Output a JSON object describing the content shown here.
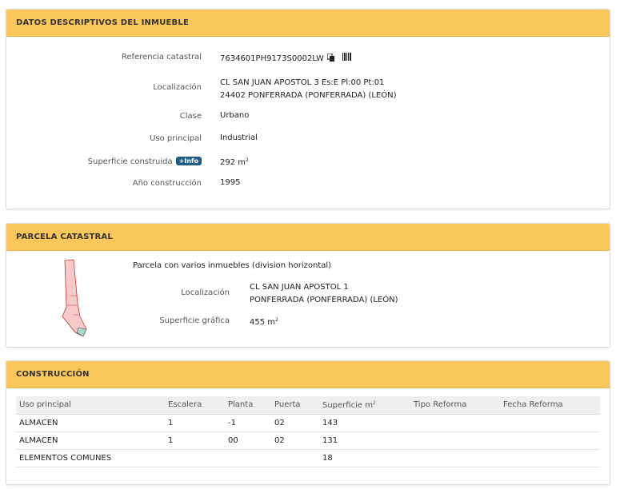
{
  "datos": {
    "title": "DATOS DESCRIPTIVOS DEL INMUEBLE",
    "ref_label": "Referencia catastral",
    "ref_value": "7634601PH9173S0002LW",
    "loc_label": "Localización",
    "loc_line1": "CL SAN JUAN APOSTOL 3 Es:E Pl:00 Pt:01",
    "loc_line2": "24402 PONFERRADA (PONFERRADA) (LEÓN)",
    "clase_label": "Clase",
    "clase_value": "Urbano",
    "uso_label": "Uso principal",
    "uso_value": "Industrial",
    "sup_label": "Superficie construida",
    "info_badge": "+Info",
    "sup_value": "292 m",
    "sup_unit_exp": "2",
    "anio_label": "Año construcción",
    "anio_value": "1995"
  },
  "parcela": {
    "title": "PARCELA CATASTRAL",
    "description": "Parcela con varios inmuebles (division horizontal)",
    "loc_label": "Localización",
    "loc_line1": "CL SAN JUAN APOSTOL 1",
    "loc_line2": "PONFERRADA (PONFERRADA) (LEÓN)",
    "sup_label": "Superficie gráfica",
    "sup_value": "455 m",
    "sup_unit_exp": "2"
  },
  "construccion": {
    "title": "CONSTRUCCIÓN",
    "headers": [
      "Uso principal",
      "Escalera",
      "Planta",
      "Puerta",
      "Superficie m",
      "Tipo Reforma",
      "Fecha Reforma"
    ],
    "sup_header_exp": "2",
    "rows": [
      [
        "ALMACEN",
        "1",
        "-1",
        "02",
        "143",
        "",
        ""
      ],
      [
        "ALMACEN",
        "1",
        "00",
        "02",
        "131",
        "",
        ""
      ],
      [
        "ELEMENTOS COMUNES",
        "",
        "",
        "",
        "18",
        "",
        ""
      ]
    ]
  },
  "colors": {
    "header_bg": "#fbc75a",
    "badge_bg": "#1f5f86",
    "parcel_fill": "#f7c9c9",
    "parcel_stroke": "#c0392b"
  },
  "icons": [
    "copy-icon",
    "barcode-icon",
    "parcel-map"
  ]
}
